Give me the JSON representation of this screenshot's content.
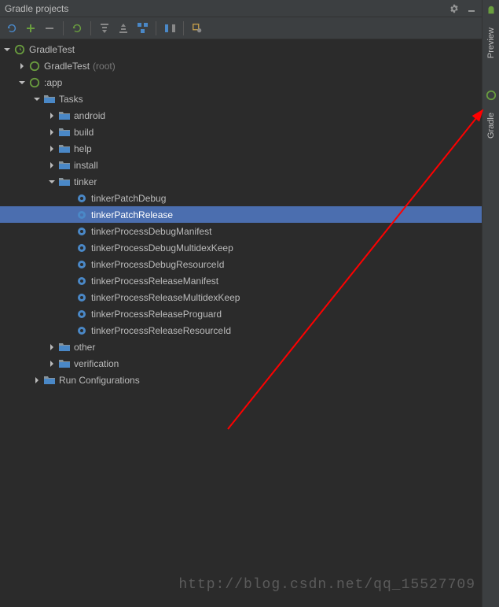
{
  "panel": {
    "title": "Gradle projects"
  },
  "right_tabs": {
    "preview": "Preview",
    "gradle": "Gradle"
  },
  "tree": {
    "root": "GradleTest",
    "root_sub": "GradleTest",
    "root_sub_suffix": "(root)",
    "app": ":app",
    "tasks": "Tasks",
    "folders": {
      "android": "android",
      "build": "build",
      "help": "help",
      "install": "install",
      "tinker": "tinker",
      "other": "other",
      "verification": "verification"
    },
    "tinker_tasks": {
      "t1": "tinkerPatchDebug",
      "t2": "tinkerPatchRelease",
      "t3": "tinkerProcessDebugManifest",
      "t4": "tinkerProcessDebugMultidexKeep",
      "t5": "tinkerProcessDebugResourceId",
      "t6": "tinkerProcessReleaseManifest",
      "t7": "tinkerProcessReleaseMultidexKeep",
      "t8": "tinkerProcessReleaseProguard",
      "t9": "tinkerProcessReleaseResourceId"
    },
    "run_config": "Run Configurations"
  },
  "watermark": "http://blog.csdn.net/qq_15527709"
}
